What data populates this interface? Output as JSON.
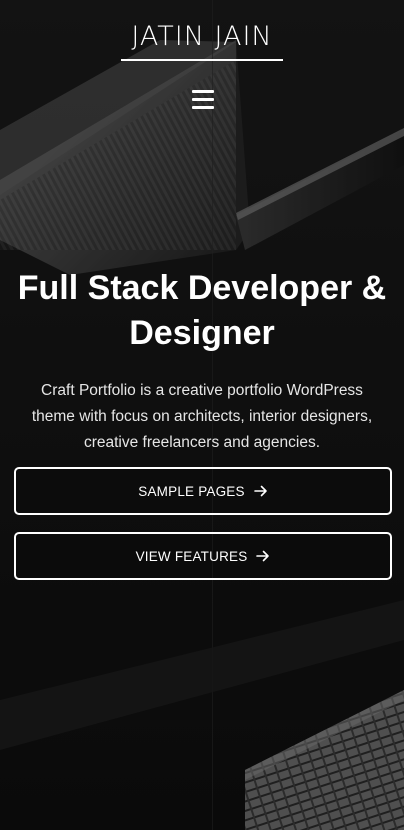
{
  "header": {
    "site_title": "JATIN JAIN",
    "menu_icon": "hamburger-menu-icon"
  },
  "hero": {
    "title": "Full Stack Developer & Designer",
    "description": "Craft Portfolio is a creative portfolio WordPress theme with focus on architects, interior designers, creative freelancers and agencies."
  },
  "buttons": [
    {
      "label": "SAMPLE PAGES",
      "icon": "arrow-right-icon"
    },
    {
      "label": "VIEW FEATURES",
      "icon": "arrow-right-icon"
    }
  ],
  "colors": {
    "background": "#111111",
    "text": "#ffffff",
    "button_border": "#ffffff"
  }
}
